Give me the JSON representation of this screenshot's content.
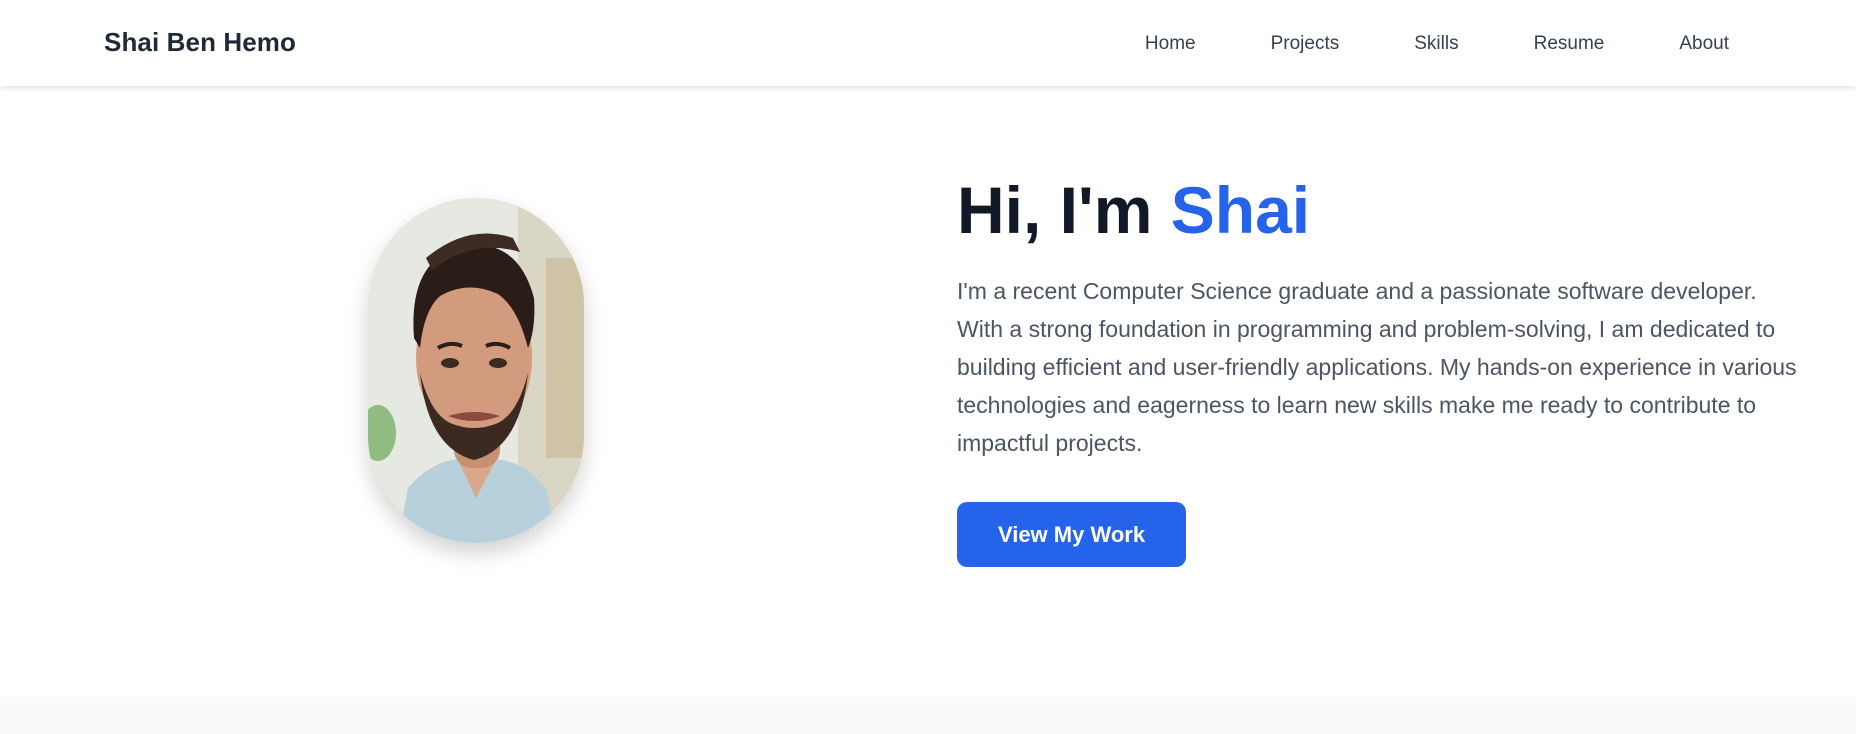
{
  "nav": {
    "brand": "Shai Ben Hemo",
    "links": [
      {
        "label": "Home"
      },
      {
        "label": "Projects"
      },
      {
        "label": "Skills"
      },
      {
        "label": "Resume"
      },
      {
        "label": "About"
      }
    ]
  },
  "hero": {
    "greeting": "Hi, I'm ",
    "name": "Shai",
    "intro": "I'm a recent Computer Science graduate and a passionate software developer. With a strong foundation in programming and problem-solving, I am dedicated to building efficient and user-friendly applications. My hands-on experience in various technologies and eagerness to learn new skills make me ready to contribute to impactful projects.",
    "cta_label": "View My Work"
  },
  "colors": {
    "accent": "#2563eb",
    "heading": "#111827",
    "body_text": "#4b5563",
    "nav_text": "#374151"
  }
}
